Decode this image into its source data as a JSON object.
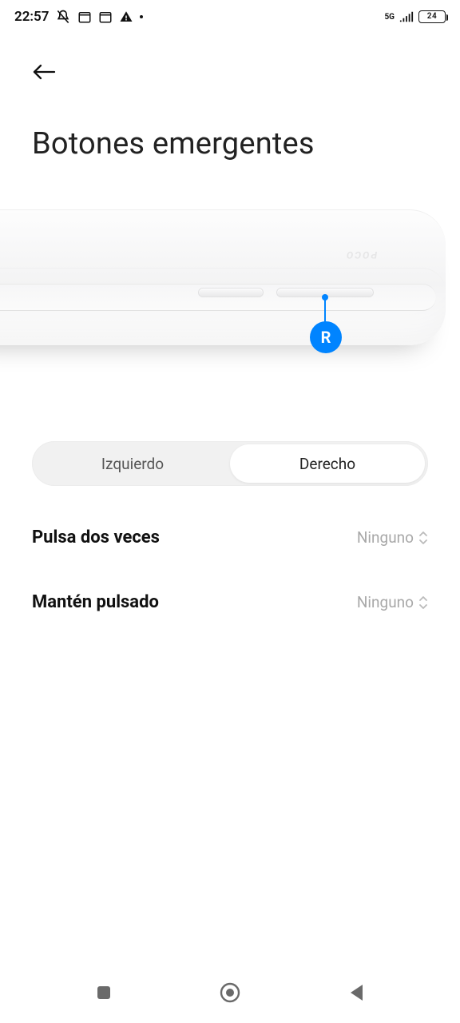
{
  "status": {
    "time": "22:57",
    "network_label": "5G",
    "battery_text": "24"
  },
  "header": {
    "title": "Botones emergentes"
  },
  "illustration": {
    "brand": "POCO",
    "marker_label": "R"
  },
  "segmented": {
    "left_label": "Izquierdo",
    "right_label": "Derecho",
    "active": "right"
  },
  "options": {
    "double_press": {
      "label": "Pulsa dos veces",
      "value": "Ninguno"
    },
    "long_press": {
      "label": "Mantén pulsado",
      "value": "Ninguno"
    }
  }
}
